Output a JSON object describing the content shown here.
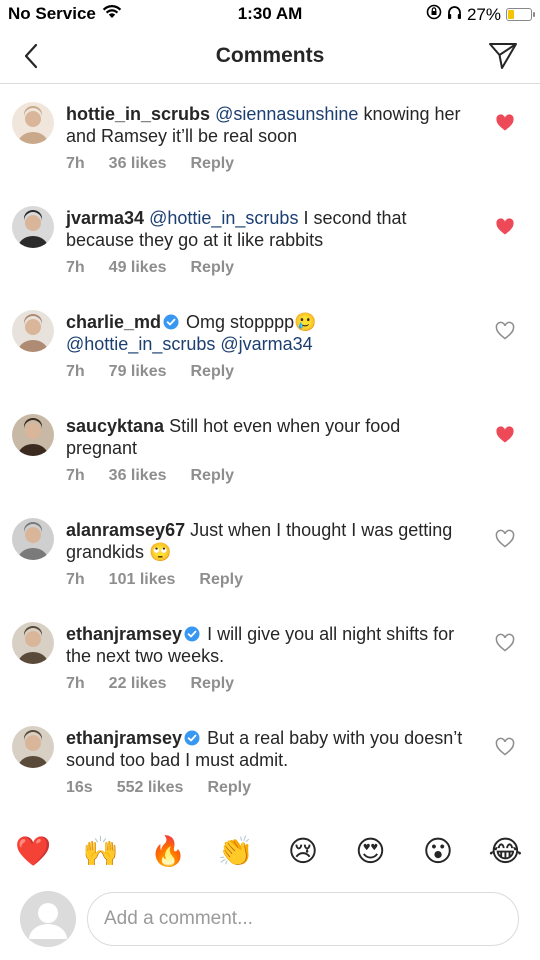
{
  "status_bar": {
    "carrier": "No Service",
    "time": "1:30 AM",
    "battery_percent": "27%",
    "battery_level": 0.27,
    "wifi_icon": "wifi-icon",
    "accent_battery": "#f5c400"
  },
  "header": {
    "title": "Comments",
    "back_icon": "chevron-left-icon",
    "share_icon": "send-icon"
  },
  "colors": {
    "like_active": "#ed4956",
    "mention": "#1c3f72",
    "verified": "#3897f0",
    "meta_text": "#8e8e8e"
  },
  "comments": [
    {
      "username": "hottie_in_scrubs",
      "verified": false,
      "mentions": "@siennasunshine",
      "text": " knowing her and Ramsey it’ll be real soon",
      "trailing_mentions": "",
      "emoji": "",
      "time": "7h",
      "likes": "36 likes",
      "reply": "Reply",
      "liked": true
    },
    {
      "username": "jvarma34",
      "verified": false,
      "mentions": "@hottie_in_scrubs",
      "text": " I second that because they go at it like rabbits",
      "trailing_mentions": "",
      "emoji": "",
      "time": "7h",
      "likes": "49 likes",
      "reply": "Reply",
      "liked": true
    },
    {
      "username": "charlie_md",
      "verified": true,
      "mentions": "",
      "text": " Omg stopppp",
      "trailing_mentions": "@hottie_in_scrubs @jvarma34",
      "emoji": "🥲",
      "time": "7h",
      "likes": "79 likes",
      "reply": "Reply",
      "liked": false
    },
    {
      "username": "saucyktana",
      "verified": false,
      "mentions": "",
      "text": " Still hot even when your food pregnant",
      "trailing_mentions": "",
      "emoji": "",
      "time": "7h",
      "likes": "36 likes",
      "reply": "Reply",
      "liked": true
    },
    {
      "username": "alanramsey67",
      "verified": false,
      "mentions": "",
      "text": " Just when I thought I was getting grandkids ",
      "trailing_mentions": "",
      "emoji": "🙄",
      "time": "7h",
      "likes": "101 likes",
      "reply": "Reply",
      "liked": false
    },
    {
      "username": "ethanjramsey",
      "verified": true,
      "mentions": "",
      "text": " I will give you all night shifts for the next two weeks.",
      "trailing_mentions": "",
      "emoji": "",
      "time": "7h",
      "likes": "22 likes",
      "reply": "Reply",
      "liked": false
    },
    {
      "username": "ethanjramsey",
      "verified": true,
      "mentions": "",
      "text": " But a real baby with you doesn’t sound too bad I must admit.",
      "trailing_mentions": "",
      "emoji": "",
      "time": "16s",
      "likes": "552 likes",
      "reply": "Reply",
      "liked": false
    }
  ],
  "emoji_bar": [
    "❤️",
    "🙌",
    "🔥",
    "👏",
    "😢",
    "😍",
    "😮",
    "😂"
  ],
  "input": {
    "placeholder": "Add a comment...",
    "value": ""
  }
}
